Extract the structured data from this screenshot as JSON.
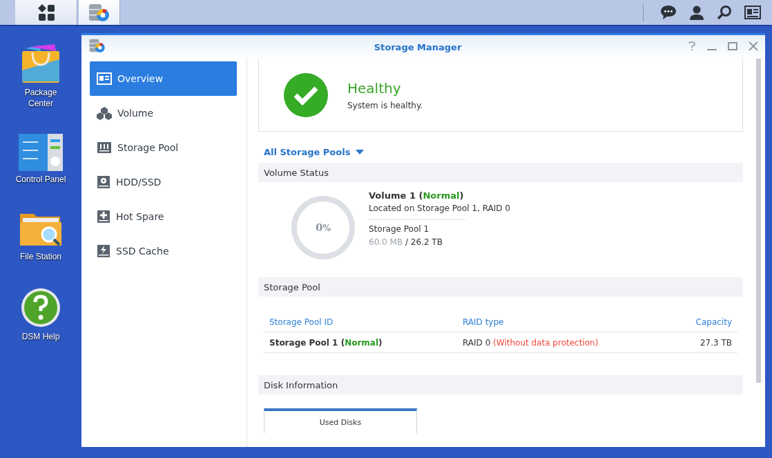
{
  "taskbar": {
    "apps": [
      {
        "kind": "menu",
        "selected": false
      },
      {
        "kind": "storage",
        "selected": true
      }
    ]
  },
  "desktop_icons": [
    {
      "kind": "package",
      "label": "Package Center"
    },
    {
      "kind": "control",
      "label": "Control Panel"
    },
    {
      "kind": "files",
      "label": "File Station"
    },
    {
      "kind": "help",
      "label": "DSM Help"
    }
  ],
  "window": {
    "title": "Storage Manager"
  },
  "sidebar": {
    "items": [
      {
        "kind": "overview",
        "label": "Overview",
        "selected": true
      },
      {
        "kind": "volume",
        "label": "Volume",
        "selected": false
      },
      {
        "kind": "pool",
        "label": "Storage Pool",
        "selected": false
      },
      {
        "kind": "hdd",
        "label": "HDD/SSD",
        "selected": false
      },
      {
        "kind": "spare",
        "label": "Hot Spare",
        "selected": false
      },
      {
        "kind": "cache",
        "label": "SSD Cache",
        "selected": false
      }
    ]
  },
  "health": {
    "title": "Healthy",
    "message": "System is healthy."
  },
  "pool_filter": {
    "label": "All Storage Pools"
  },
  "volume_status": {
    "heading": "Volume Status",
    "usage": {
      "number": "0",
      "unit": "%",
      "level": 0
    },
    "name": "Volume 1 (",
    "status": "Normal",
    "name_end": ")",
    "location": "Located on Storage Pool 1, RAID 0",
    "pool": "Storage Pool 1",
    "used": "60.0 MB",
    "total": "/ 26.2 TB"
  },
  "storage_pool": {
    "heading": "Storage Pool",
    "columns": [
      "Storage Pool ID",
      "RAID type",
      "Capacity"
    ],
    "rows": [
      {
        "name": "Storage Pool 1 (",
        "status": "Normal",
        "name_end": ")",
        "raid": "RAID 0",
        "raid_note": "(Without data protection)",
        "capacity": "27.3 TB"
      }
    ]
  },
  "disk_info": {
    "heading": "Disk Information",
    "tabs": [
      {
        "label": "Used Disks",
        "selected": true
      }
    ]
  }
}
